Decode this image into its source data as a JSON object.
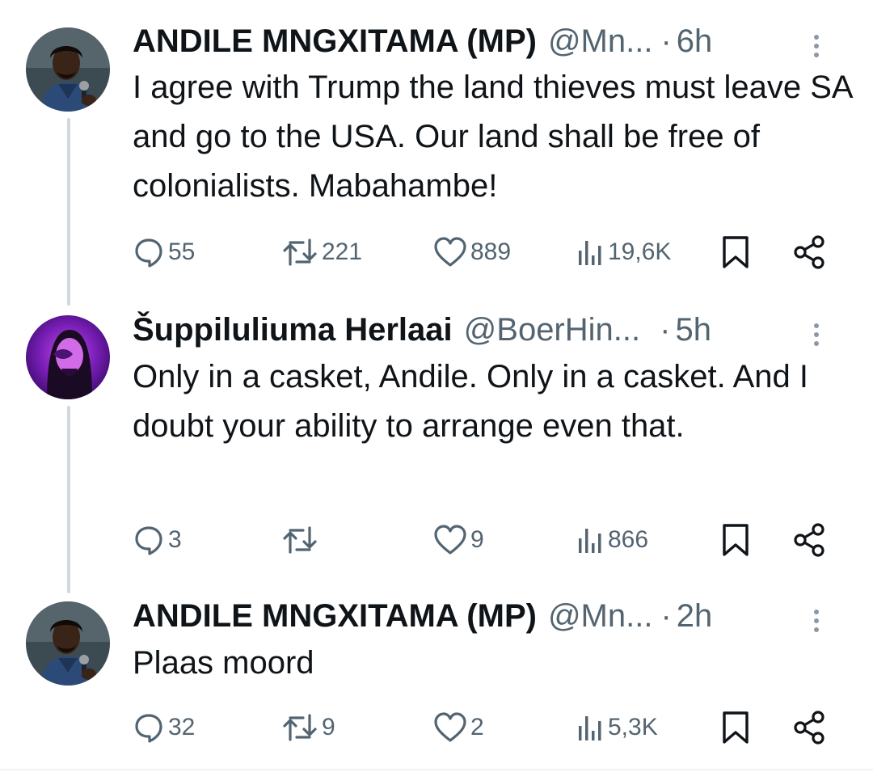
{
  "tweets": [
    {
      "name": "ANDILE MNGXITAMA (MP)",
      "handle": "@Mn...",
      "separator": "·",
      "time": "6h",
      "text": "I agree with Trump the land thieves must leave SA and go to the USA. Our land shall be free of colonialists. Mabahambe!",
      "replies": "55",
      "reposts": "221",
      "likes": "889",
      "views": "19,6K",
      "avatar_icon": "person-with-microphone-avatar"
    },
    {
      "name": "Šuppiluliuma Herlaai",
      "handle": "@BoerHin...",
      "separator": "·",
      "time": "5h",
      "text": "Only in a casket, Andile. Only in a casket. And I doubt your ability to arrange even that.",
      "replies": "3",
      "reposts": "",
      "likes": "9",
      "views": "866",
      "avatar_icon": "purple-portrait-avatar"
    },
    {
      "name": "ANDILE MNGXITAMA (MP)",
      "handle": "@Mn...",
      "separator": "·",
      "time": "2h",
      "text": "Plaas moord",
      "replies": "32",
      "reposts": "9",
      "likes": "2",
      "views": "5,3K",
      "avatar_icon": "person-with-microphone-avatar"
    }
  ],
  "colors": {
    "text": "#0f1419",
    "muted": "#536471",
    "thread_line": "#cfd9de"
  }
}
